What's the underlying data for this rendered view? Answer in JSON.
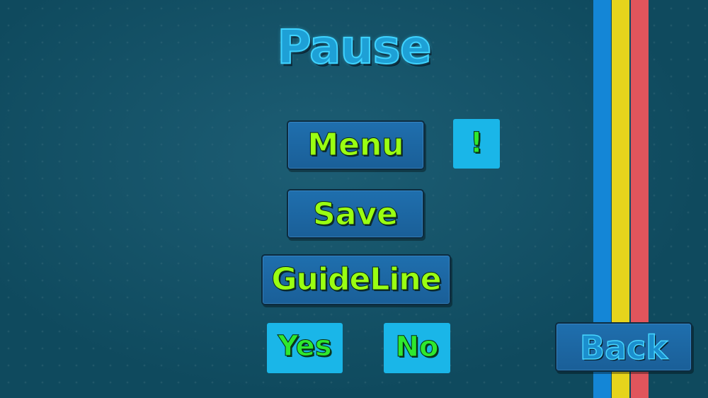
{
  "title": "Pause",
  "buttons": {
    "menu": "Menu",
    "save": "Save",
    "guideline": "GuideLine",
    "back": "Back"
  },
  "hint": "!",
  "confirm": {
    "yes": "Yes",
    "no": "No"
  },
  "stripes": {
    "blue": "#1486d6",
    "yellow": "#e6d41c",
    "red": "#e0555c"
  },
  "colors": {
    "background": "#0f4a5e",
    "button_fill": "#1f6fae",
    "button_text": "#9aff12",
    "square_fill": "#1ab6e8"
  }
}
